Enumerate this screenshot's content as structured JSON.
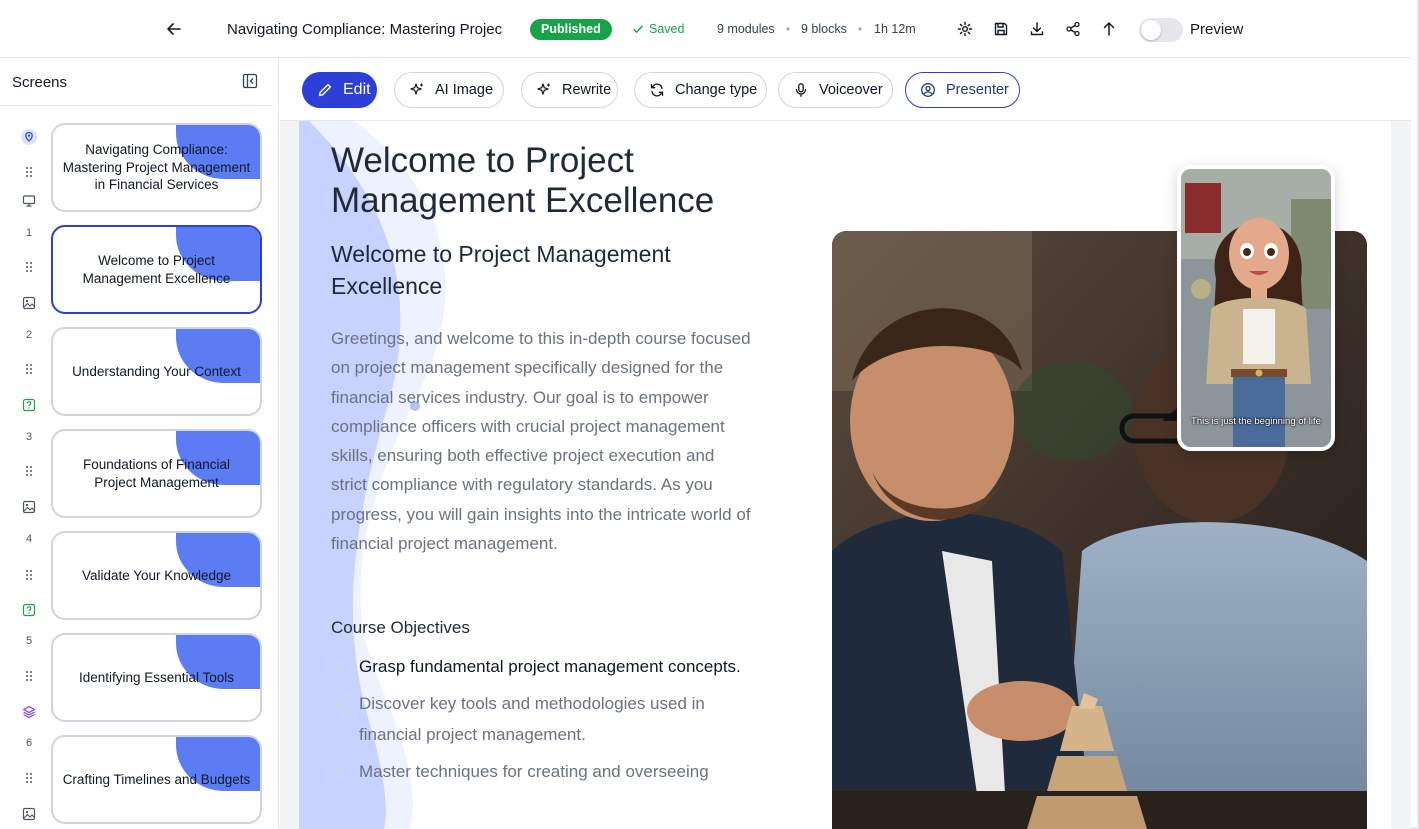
{
  "header": {
    "title": "Navigating Compliance: Mastering Project M",
    "status_badge": "Published",
    "saved_label": "Saved",
    "modules": "9 modules",
    "blocks": "9 blocks",
    "duration": "1h 12m",
    "preview_label": "Preview",
    "preview_enabled": false,
    "icons": [
      "arrow-left-icon",
      "gear-icon",
      "save-icon",
      "download-icon",
      "share-icon",
      "arrow-up-icon"
    ]
  },
  "sidebar": {
    "title": "Screens",
    "screens": [
      {
        "number": "",
        "icon": "location-pin-icon",
        "title": "Navigating Compliance: Mastering Project Management in Financial Services",
        "active": false
      },
      {
        "number": "1",
        "icon": "presentation-icon",
        "title": "Welcome to Project Management Excellence",
        "active": true
      },
      {
        "number": "2",
        "icon": "image-icon",
        "title": "Understanding Your Context",
        "active": false
      },
      {
        "number": "3",
        "icon": "quiz-icon",
        "title": "Foundations of Financial Project Management",
        "active": false
      },
      {
        "number": "4",
        "icon": "image-icon",
        "title": "Validate Your Knowledge",
        "active": false
      },
      {
        "number": "5",
        "icon": "quiz-icon",
        "title": "Identifying Essential Tools",
        "active": false
      },
      {
        "number": "6",
        "icon": "layers-icon",
        "title": "Crafting Timelines and Budgets",
        "active": false
      }
    ]
  },
  "toolbar": {
    "edit": "Edit",
    "ai_image": "AI Image",
    "rewrite": "Rewrite",
    "change_type": "Change type",
    "voiceover": "Voiceover",
    "presenter": "Presenter"
  },
  "slide": {
    "title": "Welcome to Project Management Excellence",
    "subtitle": "Welcome to Project Management Excellence",
    "body": "Greetings, and welcome to this in-depth course focused on project management specifically designed for the financial services industry. Our goal is to empower compliance officers with crucial project management skills, ensuring both effective project execution and strict compliance with regulatory standards. As you progress, you will gain insights into the intricate world of financial project management.",
    "objectives_heading": "Course Objectives",
    "objectives": [
      "Grasp fundamental project management concepts.",
      "Discover key tools and methodologies used in financial project management.",
      "Master techniques for creating and overseeing"
    ],
    "presenter_caption": "This is just the beginning of life"
  },
  "colors": {
    "brand": "#2d3fd6",
    "published": "#16a34a",
    "card_accent": "#5b7cf3",
    "wave": "#c7d2fe"
  }
}
